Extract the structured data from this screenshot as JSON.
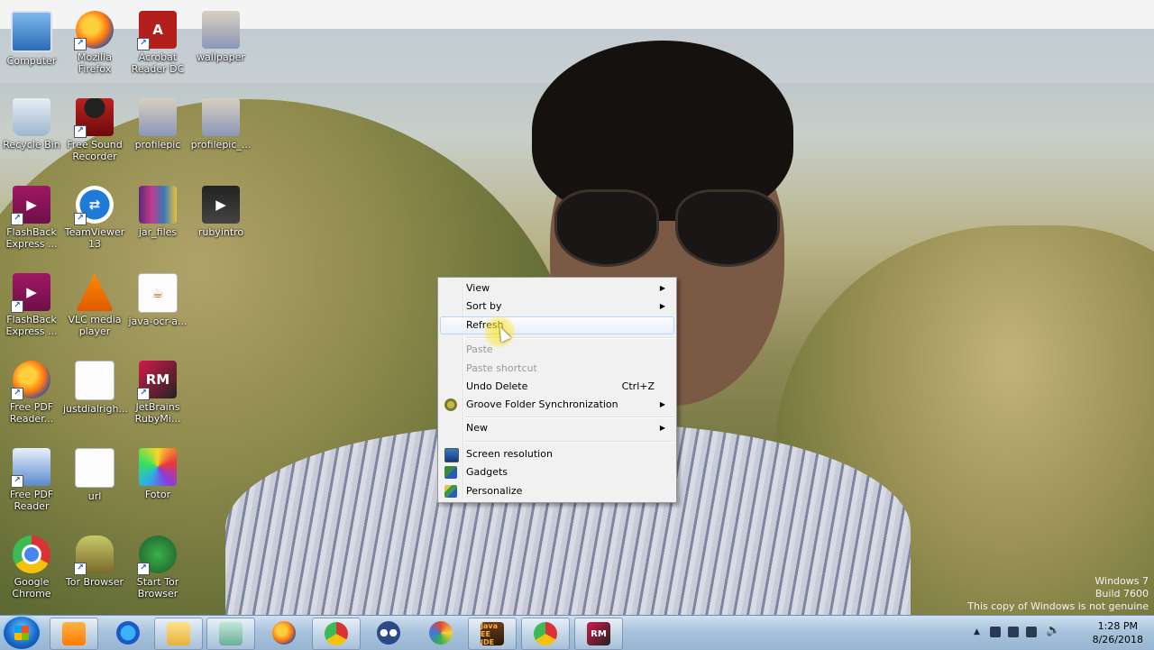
{
  "desktop": {
    "icons": [
      {
        "label": "Computer",
        "icon": "computer-icon"
      },
      {
        "label": "Mozilla Firefox",
        "icon": "firefox-icon"
      },
      {
        "label": "Acrobat Reader DC",
        "icon": "acrobat-icon"
      },
      {
        "label": "wallpaper",
        "icon": "image-file-icon"
      },
      {
        "label": "Recycle Bin",
        "icon": "recycle-bin-icon"
      },
      {
        "label": "Free Sound Recorder",
        "icon": "microphone-icon"
      },
      {
        "label": "profilepic",
        "icon": "image-file-icon"
      },
      {
        "label": "profilepic_...",
        "icon": "image-file-icon"
      },
      {
        "label": "FlashBack Express ...",
        "icon": "flashback-icon"
      },
      {
        "label": "TeamViewer 13",
        "icon": "teamviewer-icon"
      },
      {
        "label": "jar_files",
        "icon": "winrar-icon"
      },
      {
        "label": "rubyintro",
        "icon": "video-file-icon"
      },
      {
        "label": "FlashBack Express ...",
        "icon": "flashback-icon"
      },
      {
        "label": "VLC media player",
        "icon": "vlc-icon"
      },
      {
        "label": "java-ocr-a...",
        "icon": "java-file-icon"
      },
      {
        "label": "Free PDF Reader...",
        "icon": "firefox-icon"
      },
      {
        "label": "justdialrigh...",
        "icon": "document-icon"
      },
      {
        "label": "JetBrains RubyMi...",
        "icon": "rubymine-icon"
      },
      {
        "label": "Free PDF Reader",
        "icon": "pdf-reader-icon"
      },
      {
        "label": "url",
        "icon": "document-icon"
      },
      {
        "label": "Fotor",
        "icon": "fotor-icon"
      },
      {
        "label": "Google Chrome",
        "icon": "chrome-icon"
      },
      {
        "label": "Tor Browser",
        "icon": "tor-icon"
      },
      {
        "label": "Start Tor Browser",
        "icon": "tor-globe-icon"
      }
    ],
    "watermark": [
      "Windows 7",
      "Build 7600",
      "This copy of Windows is not genuine"
    ]
  },
  "context_menu": {
    "items": [
      {
        "label": "View",
        "submenu": true,
        "state": "normal"
      },
      {
        "label": "Sort by",
        "submenu": true,
        "state": "normal"
      },
      {
        "label": "Refresh",
        "submenu": false,
        "state": "hover"
      },
      {
        "label": "Paste",
        "submenu": false,
        "state": "disabled"
      },
      {
        "label": "Paste shortcut",
        "submenu": false,
        "state": "disabled"
      },
      {
        "label": "Undo Delete",
        "shortcut": "Ctrl+Z",
        "state": "normal"
      },
      {
        "label": "Groove Folder Synchronization",
        "submenu": true,
        "icon": "groove-icon",
        "state": "normal"
      },
      {
        "label": "New",
        "submenu": true,
        "state": "normal"
      },
      {
        "label": "Screen resolution",
        "icon": "screen-resolution-icon",
        "state": "normal"
      },
      {
        "label": "Gadgets",
        "icon": "gadgets-icon",
        "state": "normal"
      },
      {
        "label": "Personalize",
        "icon": "personalize-icon",
        "state": "normal"
      }
    ],
    "submenu_arrow": "▶"
  },
  "taskbar": {
    "apps": [
      {
        "icon": "windows-media-player-icon",
        "active": true
      },
      {
        "icon": "internet-explorer-icon",
        "active": false
      },
      {
        "icon": "windows-explorer-icon",
        "active": true
      },
      {
        "icon": "sticky-notes-icon",
        "active": true
      },
      {
        "icon": "firefox-icon",
        "active": false
      },
      {
        "icon": "chrome-icon",
        "active": true
      },
      {
        "icon": "eyes-app-icon",
        "active": false
      },
      {
        "icon": "paint-icon",
        "active": false
      },
      {
        "icon": "java-ee-ide-icon",
        "active": true,
        "text": "Java EE IDE"
      },
      {
        "icon": "chrome-icon",
        "active": true
      },
      {
        "icon": "rubymine-icon",
        "active": true,
        "text": "RM"
      }
    ],
    "clock": {
      "time": "1:28 PM",
      "date": "8/26/2018"
    }
  },
  "colors": {
    "taskbar": "#a9c3dd",
    "menu_bg": "#f1f1f1",
    "hover_border": "#b8d6fb",
    "disabled_text": "#9a9a9a"
  }
}
